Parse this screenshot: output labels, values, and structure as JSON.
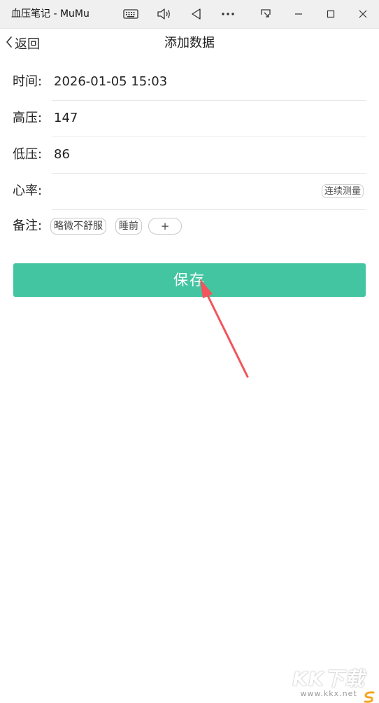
{
  "window": {
    "title": "血压笔记 - MuMu",
    "controls": [
      "keyboard-icon",
      "volume-icon",
      "back-triangle-icon",
      "more-icon",
      "screen-cast-icon",
      "minimize-icon",
      "maximize-icon",
      "close-icon"
    ]
  },
  "header": {
    "back_label": "返回",
    "title": "添加数据"
  },
  "form": {
    "time": {
      "label": "时间:",
      "value": "2026-01-05 15:03"
    },
    "systolic": {
      "label": "高压:",
      "value": "147"
    },
    "diastolic": {
      "label": "低压:",
      "value": "86"
    },
    "heart_rate": {
      "label": "心率:",
      "value": "",
      "measure_button": "连续测量"
    },
    "notes": {
      "label": "备注:",
      "tags": [
        "略微不舒服",
        "睡前"
      ],
      "add_label": "+"
    }
  },
  "save_button": "保存",
  "annotation": {
    "arrow_color": "#f2555c"
  },
  "accent_color": "#43c5a1",
  "watermark": {
    "main": "KK下载",
    "sub": "www.kkx.net"
  }
}
